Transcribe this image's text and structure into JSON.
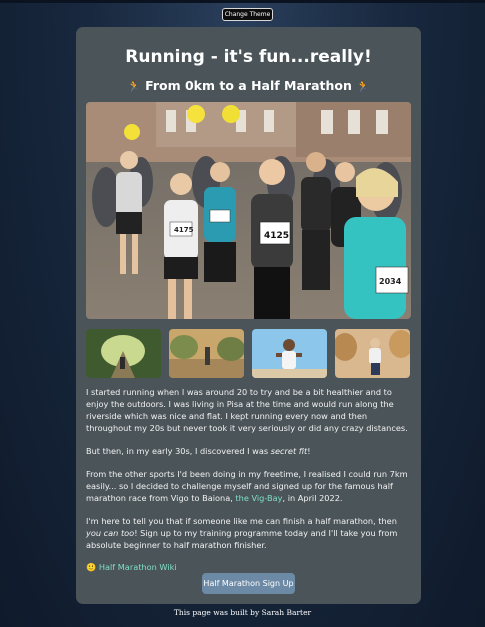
{
  "header": {
    "theme_button": "Change Theme"
  },
  "card": {
    "title": "Running - it's fun...really!",
    "subtitle": "From 0km to a Half Marathon",
    "subtitle_icon": "🏃"
  },
  "hero": {
    "numbers": [
      "4175",
      "4125",
      "2034"
    ]
  },
  "paragraphs": {
    "p1": "I started running when I was around 20 to try and be a bit healthier and to enjoy the outdoors. I was living in Pisa at the time and would run along the riverside which was nice and flat. I kept running every now and then throughout my 20s but never took it very seriously or did any crazy distances.",
    "p2_a": "But then, in my early 30s, I discovered I was ",
    "p2_em": "secret fit",
    "p2_b": "!",
    "p3_a": "From the other sports I'd been doing in my freetime, I realised I could run 7km easily... so I decided to challenge myself and signed up for the famous half marathon race from Vigo to Baiona, ",
    "p3_link": "the Vig-Bay",
    "p3_b": ", in April 2022.",
    "p4_a": "I'm here to tell you that if someone like me can finish a half marathon, then ",
    "p4_em": "you can too",
    "p4_b": "! Sign up to my training programme today and I'll take you from absolute beginner to half marathon finisher."
  },
  "wiki": {
    "icon": "🙂",
    "label": "Half Marathon Wiki"
  },
  "signup_button": "Half Marathon Sign Up",
  "footer": "This page was built by Sarah Barter"
}
